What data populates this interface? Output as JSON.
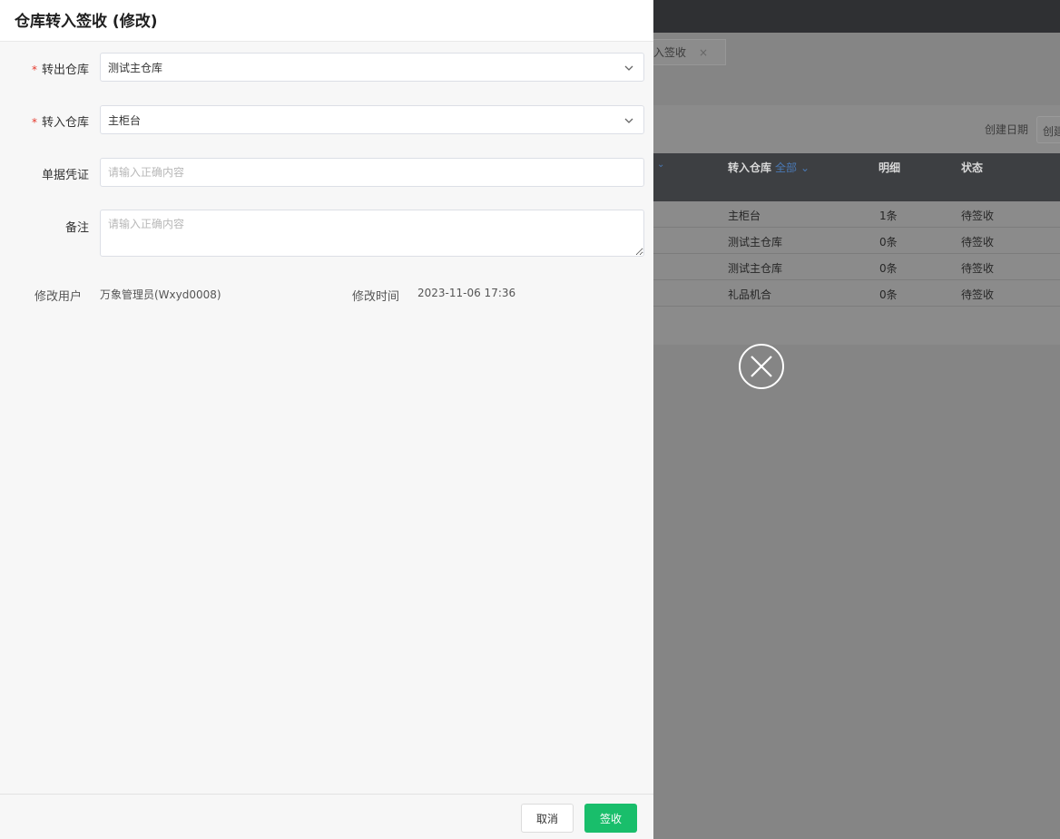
{
  "background": {
    "tab_label": "入签收",
    "tab_close": "×",
    "date_label": "创建日期",
    "date_input": "创建",
    "table": {
      "headers": {
        "in_warehouse": "转入仓库",
        "filter": "全部",
        "detail": "明细",
        "status": "状态"
      },
      "rows": [
        {
          "warehouse": "主柜台",
          "detail": "1条",
          "status": "待签收"
        },
        {
          "warehouse": "测试主仓库",
          "detail": "0条",
          "status": "待签收"
        },
        {
          "warehouse": "测试主仓库",
          "detail": "0条",
          "status": "待签收"
        },
        {
          "warehouse": "礼品机合",
          "detail": "0条",
          "status": "待签收"
        }
      ]
    }
  },
  "drawer": {
    "title": "仓库转入签收 (修改)",
    "required_mark": "*",
    "out_warehouse": {
      "label": "转出仓库",
      "value": "测试主仓库"
    },
    "in_warehouse": {
      "label": "转入仓库",
      "value": "主柜台"
    },
    "voucher": {
      "label": "单据凭证",
      "placeholder": "请输入正确内容"
    },
    "remark": {
      "label": "备注",
      "placeholder": "请输入正确内容"
    },
    "modify_user": {
      "label": "修改用户",
      "value": "万象管理员(Wxyd0008)"
    },
    "modify_time": {
      "label": "修改时间",
      "value": "2023-11-06 17:36"
    },
    "cancel_label": "取消",
    "sign_label": "签收"
  },
  "colors": {
    "primary_button": "#19be6b",
    "required": "#e5392c",
    "filter_link": "#4a79b5"
  }
}
